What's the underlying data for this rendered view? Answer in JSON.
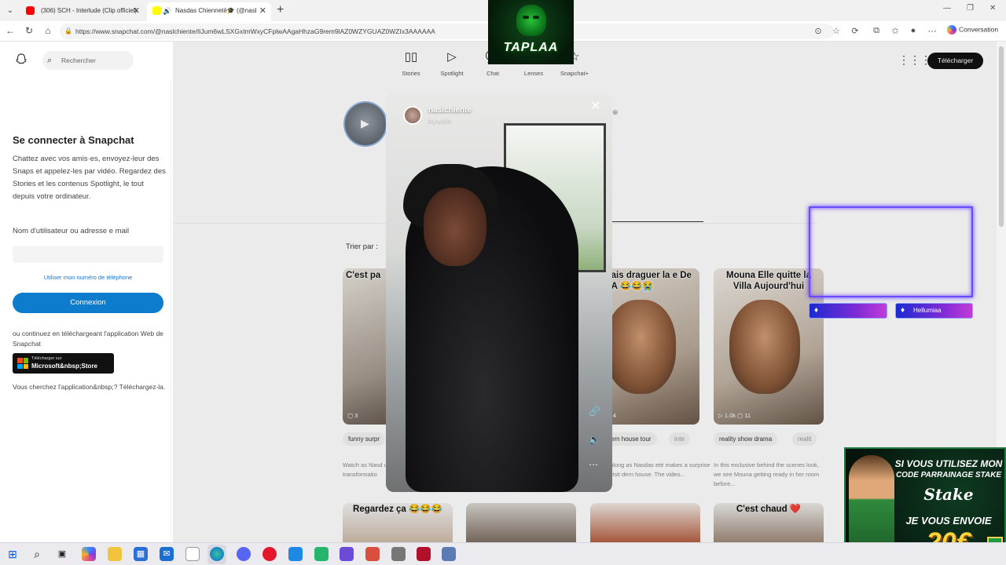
{
  "browser": {
    "tabs": [
      {
        "title": "(306) SCH - Interlude (Clip officiel)",
        "favicon_color": "#ff0000"
      },
      {
        "title": "Nasdas Chiennetē🎓 (@nasl",
        "favicon_color": "#fffc00",
        "audio": true
      }
    ],
    "url": "https://www.snapchat.com/@naslchiente/lIJum6wLSXGxtmWxyCFplwAAgaHhzaG9rem9lAZ0WZYGUAZ0WZIx3AAAAAA",
    "copilot_label": "Conversation"
  },
  "snapchat": {
    "search_placeholder": "Rechercher",
    "nav": [
      {
        "label": "Stories",
        "icon": "stories-icon"
      },
      {
        "label": "Spotlight",
        "icon": "spotlight-icon"
      },
      {
        "label": "Chat",
        "icon": "chat-icon"
      },
      {
        "label": "Lenses",
        "icon": "lenses-icon"
      },
      {
        "label": "Snapchat+",
        "icon": "snapchat-plus-icon"
      }
    ],
    "download_label": "Télécharger",
    "login": {
      "title": "Se connecter à Snapchat",
      "description": "Chattez avec vos amis·es, envoyez-leur des Snaps et appelez-les par vidéo. Regardez des Stories et les contenus Spotlight, le tout depuis votre ordinateur.",
      "username_label": "Nom d'utilisateur ou adresse e mail",
      "phone_link": "Utiliser mon numéro de téléphone",
      "connect_button": "Connexion",
      "or_text": "ou continuez en téléchargeant l'application Web de Snapchat",
      "store_line1": "Télécharger sur",
      "store_line2": "Microsoft&nbsp;Store",
      "looking_text": "Vous cherchez l'application&nbsp;? Téléchargez-la."
    },
    "sort_label": "Trier par :",
    "cards": [
      {
        "caption": "C'est pa",
        "stats": "▢ 3",
        "tag": "funny surpr",
        "desc": "Watch as Nasd unveils his liv transformatio"
      },
      {
        "caption": "voulais draguer la e De LUNA 😂😂😭",
        "stats": "▢ 6  ↗ 4",
        "tag": "ern house tour",
        "tag2": "inte",
        "desc": "along as Nasdas eté makes a surprise visit dern house. The video..."
      },
      {
        "caption": "Mouna Elle quitte la Villa Aujourd'hui",
        "stats": "▷ 1.0k  ▢ 11",
        "tag": "reality show drama",
        "tag2": "realit",
        "desc": "In this exclusive behind the scenes look, we see Mouna getting ready in her room before..."
      }
    ],
    "bottom_captions": [
      "Regardez ça 😂😂😂",
      "",
      "",
      "C'est chaud ❤️"
    ]
  },
  "story": {
    "username": "naslchiente",
    "time_ago": "Il y a 6 h"
  },
  "overlays": {
    "logo_text": "TAPLAA",
    "badges": [
      "",
      "Hellumiaa"
    ],
    "stake": {
      "line1": "SI VOUS UTILISEZ MON",
      "line2": "CODE PARRAINAGE STAKE",
      "brand": "Stake",
      "line3": "JE VOUS ENVOIE",
      "amount": "20€"
    }
  }
}
